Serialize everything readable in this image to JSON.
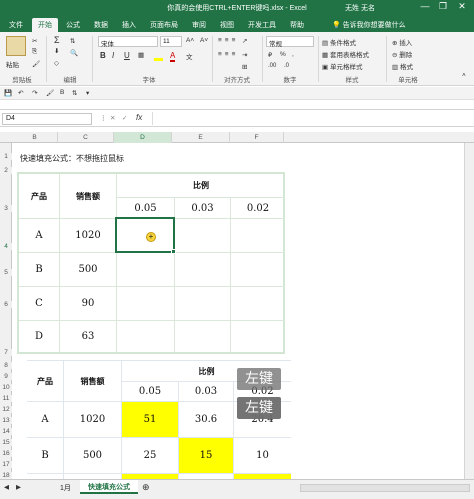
{
  "window": {
    "title": "你真的会使用CTRL+ENTER键吗.xlsx - Excel",
    "user": "无姓 无名",
    "controls": [
      "—",
      "❐",
      "✕"
    ]
  },
  "tabs": [
    "文件",
    "开始",
    "公式",
    "数据",
    "插入",
    "页面布局",
    "审阅",
    "视图",
    "开发工具",
    "帮助",
    "告诉我你想要做什么"
  ],
  "active_tab": "开始",
  "ribbon": {
    "paste": "粘贴",
    "clipboard_label": "剪贴板",
    "editing_label": "编辑",
    "font_name": "宋体",
    "font_size": "11",
    "font_label": "字体",
    "align_label": "对齐方式",
    "number_format": "常规",
    "number_label": "数字",
    "cond_format": "条件格式",
    "table_format": "套用表格格式",
    "cell_style": "单元格样式",
    "style_label": "样式",
    "insert": "插入",
    "delete": "删除",
    "format": "格式",
    "cells_label": "单元格",
    "bold": "B",
    "italic": "I",
    "underline": "U",
    "font_color_glyph": "A",
    "percent": "%",
    "comma": ",",
    "inc_decimal": ".00",
    "dec_decimal": ".0"
  },
  "formula_bar": {
    "name_box": "D4",
    "fx": "fx",
    "formula": ""
  },
  "columns": [
    "B",
    "C",
    "D",
    "E",
    "F"
  ],
  "rows": [
    "1",
    "2",
    "3",
    "4",
    "5",
    "6",
    "7",
    "8",
    "9",
    "10",
    "11",
    "12",
    "13",
    "14",
    "15",
    "16",
    "17",
    "18",
    "19"
  ],
  "sheet": {
    "note": "快速填充公式：不想拖拉鼠标",
    "table1": {
      "h_product": "产品",
      "h_sales": "销售额",
      "h_ratio": "比例",
      "ratios": [
        "0.05",
        "0.03",
        "0.02"
      ],
      "rows": [
        {
          "product": "A",
          "sales": "1020"
        },
        {
          "product": "B",
          "sales": "500"
        },
        {
          "product": "C",
          "sales": "90"
        },
        {
          "product": "D",
          "sales": "63"
        }
      ]
    },
    "table2": {
      "h_product": "产品",
      "h_sales": "销售额",
      "h_ratio": "比例",
      "ratios": [
        "0.05",
        "0.03",
        "0.02"
      ],
      "rows": [
        {
          "product": "A",
          "sales": "1020",
          "v": [
            "51",
            "30.6",
            "20.4"
          ]
        },
        {
          "product": "B",
          "sales": "500",
          "v": [
            "25",
            "15",
            "10"
          ]
        }
      ]
    },
    "key_tips": [
      "左键",
      "左键"
    ]
  },
  "sheet_tabs": [
    "1月",
    "快速填充公式"
  ],
  "active_sheet": "快速填充公式",
  "colors": {
    "excel_green": "#217346",
    "highlight": "#ffff00"
  }
}
